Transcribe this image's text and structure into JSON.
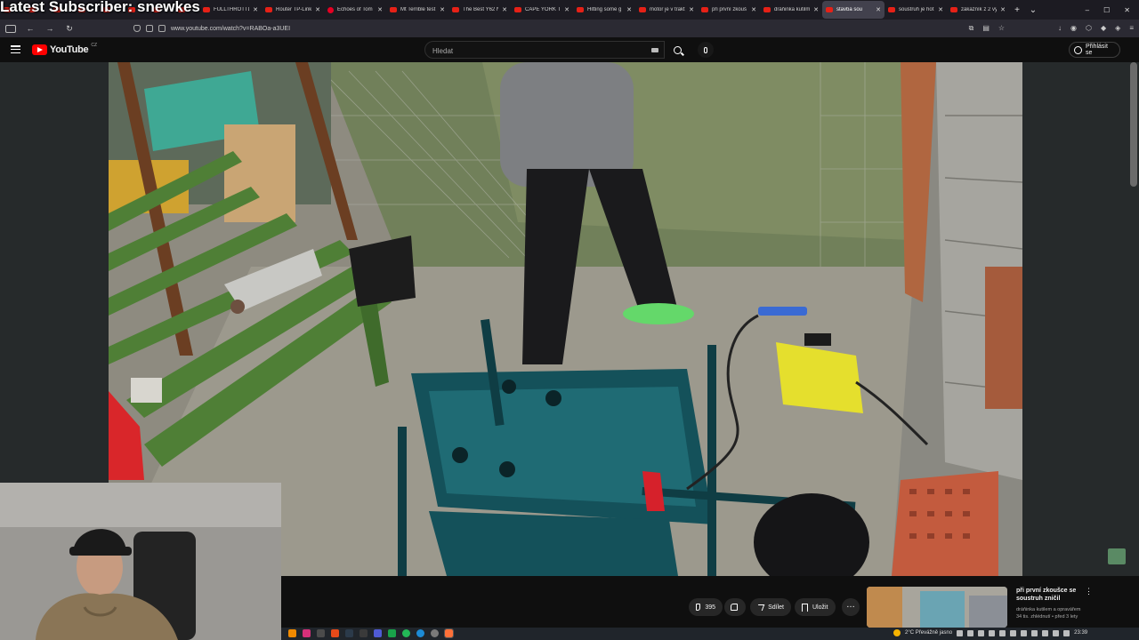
{
  "overlay": {
    "title": "Latest Subscriber: snewkes"
  },
  "browser": {
    "tabs": [
      {
        "label": "FULLTHROTTLE",
        "favicon": "youtube-icon",
        "active": false
      },
      {
        "label": "Router TP-Link",
        "favicon": "youtube-icon",
        "active": false
      },
      {
        "label": "Echoes of Tom",
        "favicon": "pinterest-icon",
        "active": false
      },
      {
        "label": "Mt Terrible test",
        "favicon": "youtube-icon",
        "active": false
      },
      {
        "label": "The Best Y62 N",
        "favicon": "youtube-icon",
        "active": false
      },
      {
        "label": "CAPE YORK TE",
        "favicon": "youtube-icon",
        "active": false
      },
      {
        "label": "Hitting some g",
        "favicon": "youtube-icon",
        "active": false
      },
      {
        "label": "motor je v trakt",
        "favicon": "youtube-icon",
        "active": false
      },
      {
        "label": "při první zkouš",
        "favicon": "youtube-icon",
        "active": false
      },
      {
        "label": "dráňinka kutilm",
        "favicon": "youtube-icon",
        "active": false
      },
      {
        "label": "stavba sou",
        "favicon": "youtube-icon",
        "active": true
      },
      {
        "label": "soustruh je hot",
        "favicon": "youtube-icon",
        "active": false
      },
      {
        "label": "zákazník z 2 vý",
        "favicon": "youtube-icon",
        "active": false
      }
    ],
    "new_tab": "+",
    "tab_list": "⌄",
    "window_controls": {
      "minimize": "–",
      "maximize": "☐",
      "close": "✕"
    },
    "url": "www.youtube.com/watch?v=RABOa-a3UEI"
  },
  "youtube": {
    "logo_text": "YouTube",
    "country_code": "CZ",
    "search_placeholder": "Hledat",
    "signin_label": "Přihlásit se",
    "actions": {
      "like_count": "395",
      "share_label": "Sdílet",
      "save_label": "Uložit",
      "more": "…"
    },
    "recommended": {
      "title": "při první zkoušce se soustruh zničil",
      "channel": "dráňinka kutilem a opravářem",
      "meta": "34 tis. zhlédnutí • před 3 lety"
    }
  },
  "taskbar": {
    "weather": "2°C  Převážně jasno",
    "time": "23:39"
  },
  "colors": {
    "youtube_red": "#ff0000",
    "background": "#0f0f0f"
  }
}
